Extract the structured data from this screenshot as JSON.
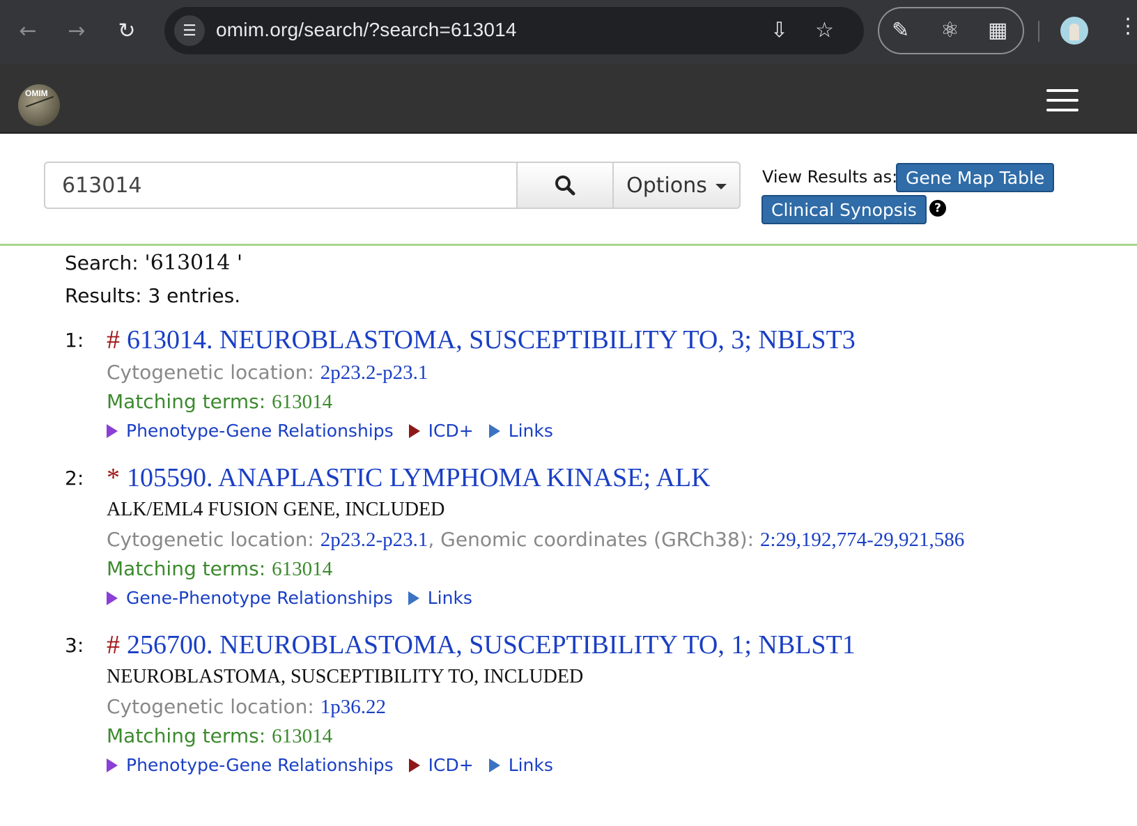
{
  "browser": {
    "url": "omim.org/search/?search=613014"
  },
  "header": {
    "logo_text": "OMIM"
  },
  "search": {
    "value": "613014",
    "options_label": "Options",
    "view_results_label": "View Results as:",
    "gene_map_table_label": "Gene Map Table",
    "clinical_synopsis_label": "Clinical Synopsis",
    "help_glyph": "?"
  },
  "results_meta": {
    "search_label": "Search:",
    "search_query": "'613014 '",
    "results_text": "Results: 3 entries."
  },
  "results": [
    {
      "num": "1:",
      "symbol": "#",
      "title": "613014. NEUROBLASTOMA, SUSCEPTIBILITY TO, 3; NBLST3",
      "cyto_label": "Cytogenetic location:",
      "cyto_value": "2p23.2-p23.1",
      "match_label": "Matching terms:",
      "match_value": "613014",
      "links": [
        {
          "label": "Phenotype-Gene Relationships",
          "color": "#8b3fd6"
        },
        {
          "label": "ICD+",
          "color": "#8e1818"
        },
        {
          "label": "Links",
          "color": "#3b73c2"
        }
      ]
    },
    {
      "num": "2:",
      "symbol": "*",
      "title": "105590. ANAPLASTIC LYMPHOMA KINASE; ALK",
      "included": "ALK/EML4 FUSION GENE, INCLUDED",
      "cyto_label": "Cytogenetic location:",
      "cyto_value": "2p23.2-p23.1",
      "genomic_label": ", Genomic coordinates (GRCh38):",
      "genomic_value": "2:29,192,774-29,921,586",
      "match_label": "Matching terms:",
      "match_value": "613014",
      "links": [
        {
          "label": "Gene-Phenotype Relationships",
          "color": "#8b3fd6"
        },
        {
          "label": "Links",
          "color": "#3b73c2"
        }
      ]
    },
    {
      "num": "3:",
      "symbol": "#",
      "title": "256700. NEUROBLASTOMA, SUSCEPTIBILITY TO, 1; NBLST1",
      "included": "NEUROBLASTOMA, SUSCEPTIBILITY TO, INCLUDED",
      "cyto_label": "Cytogenetic location:",
      "cyto_value": "1p36.22",
      "match_label": "Matching terms:",
      "match_value": "613014",
      "links": [
        {
          "label": "Phenotype-Gene Relationships",
          "color": "#8b3fd6"
        },
        {
          "label": "ICD+",
          "color": "#8e1818"
        },
        {
          "label": "Links",
          "color": "#3b73c2"
        }
      ]
    }
  ],
  "colors": {
    "link_blue": "#1a3fc4",
    "match_green": "#3c8a2e",
    "symbol_red": "#a01818",
    "button_blue": "#2f6ca8",
    "header_dark": "#333333",
    "rule_green": "#a8d48c"
  }
}
